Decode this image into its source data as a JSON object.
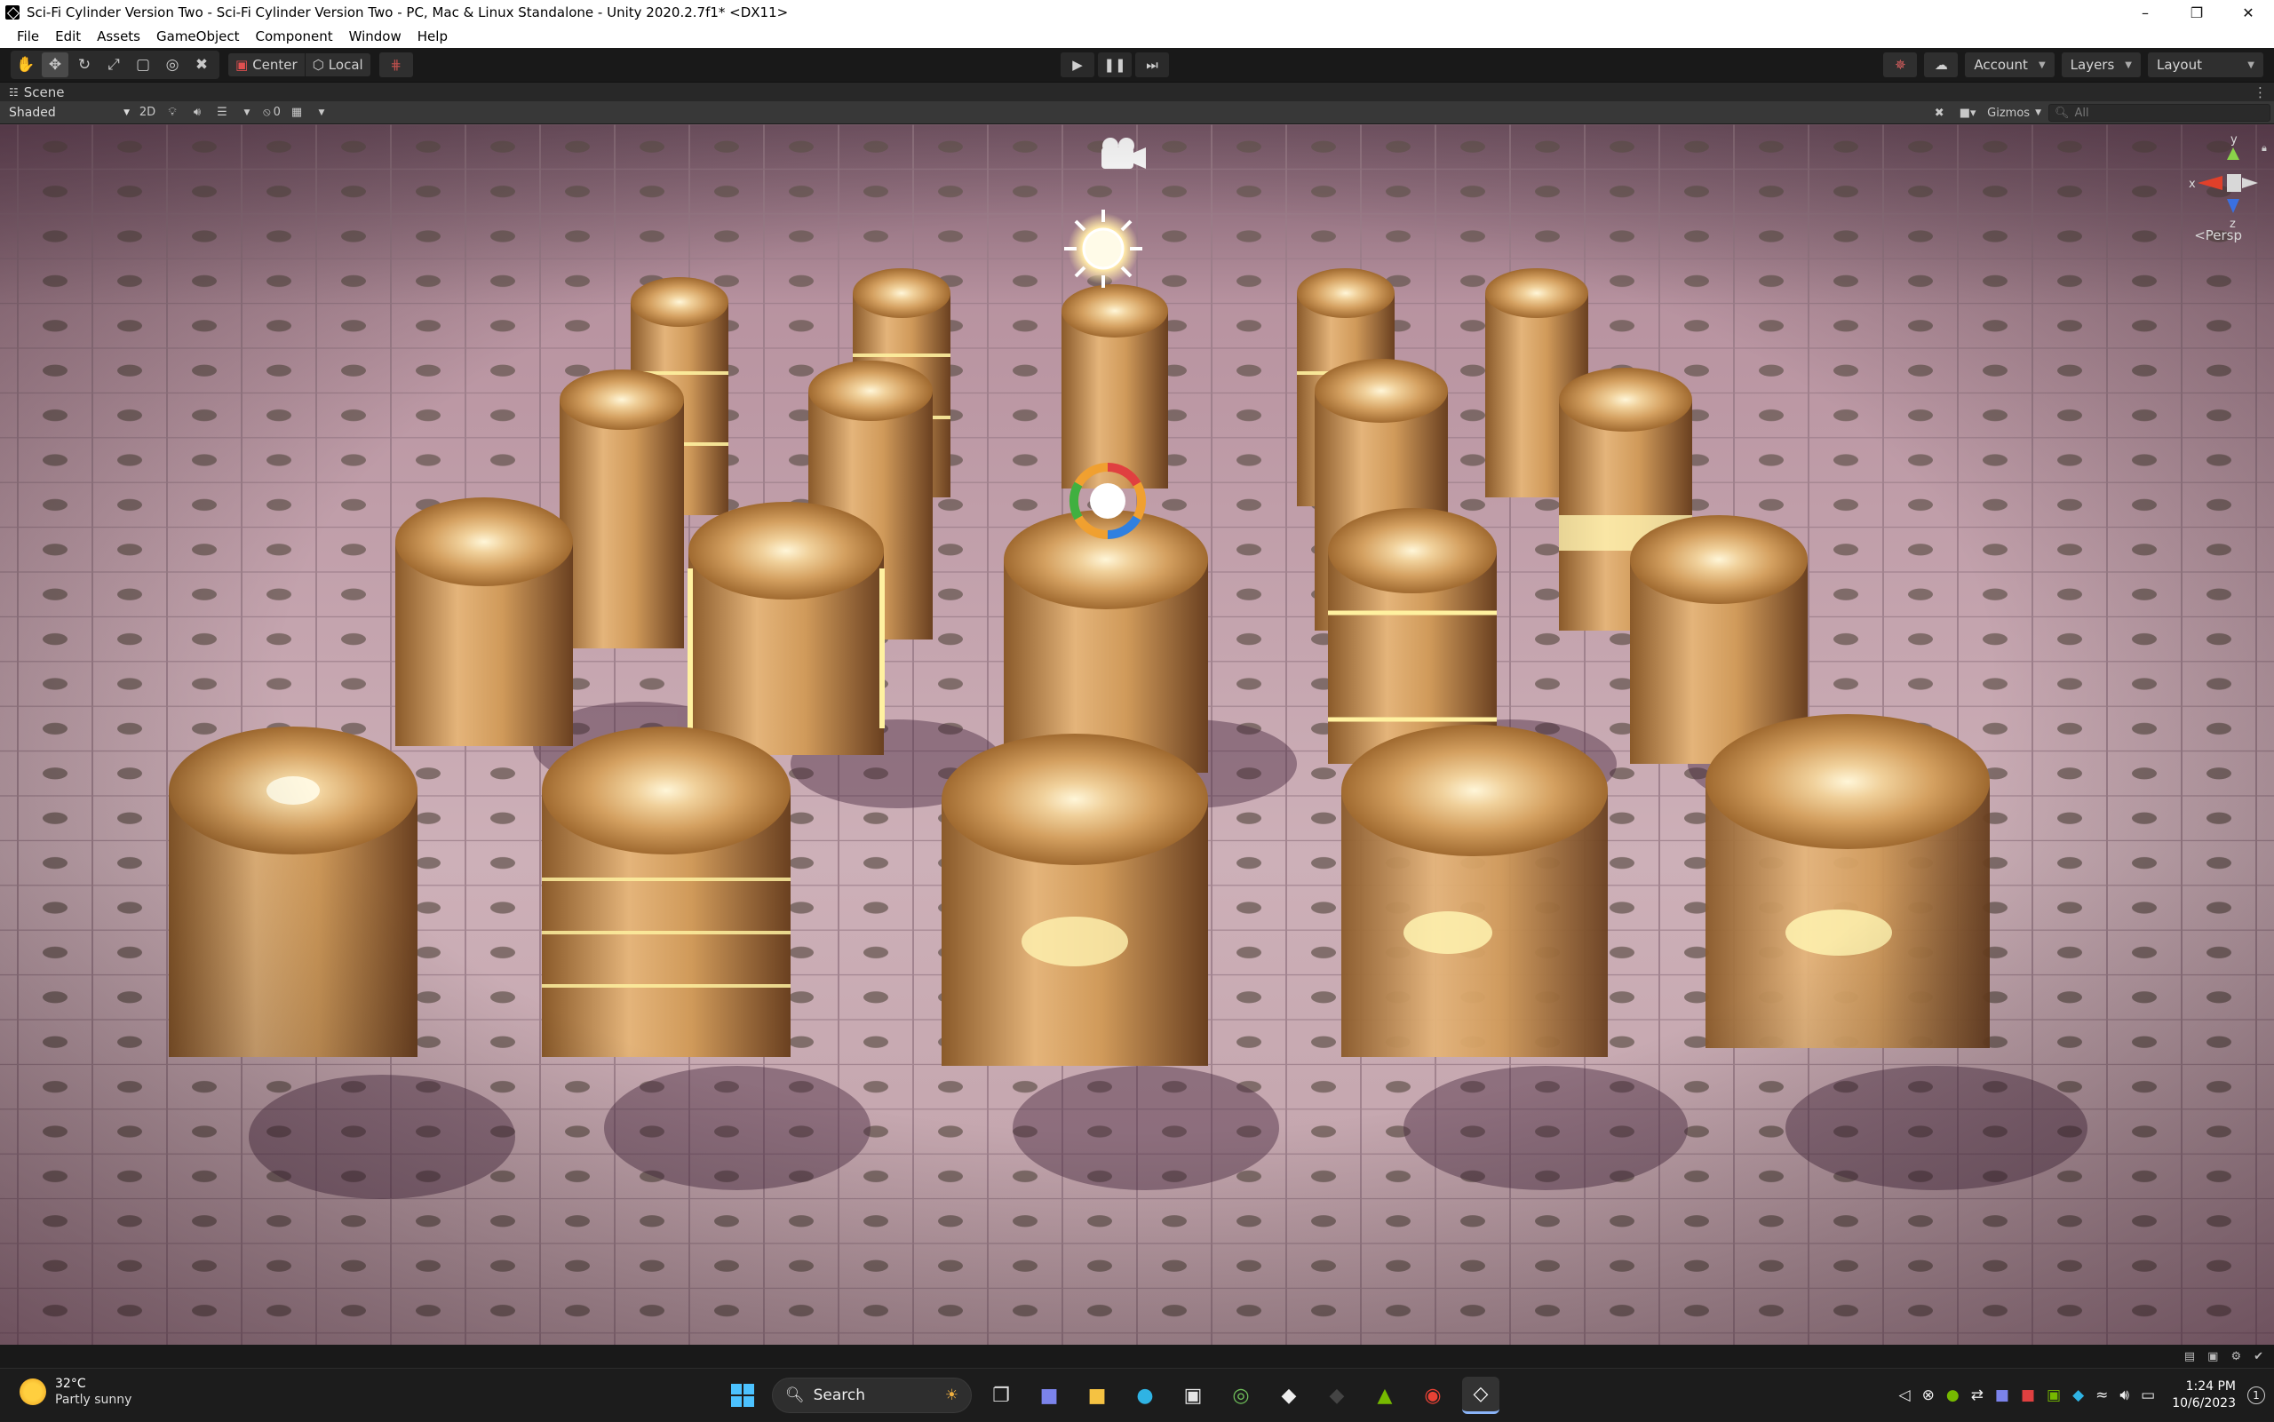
{
  "window": {
    "title": "Sci-Fi Cylinder Version Two - Sci-Fi Cylinder Version Two - PC, Mac & Linux Standalone - Unity 2020.2.7f1* <DX11>",
    "controls": [
      "minimize",
      "maximize",
      "close"
    ]
  },
  "menu": {
    "items": [
      "File",
      "Edit",
      "Assets",
      "GameObject",
      "Component",
      "Window",
      "Help"
    ]
  },
  "toolbar": {
    "tools": [
      "hand-tool",
      "move-tool",
      "rotate-tool",
      "scale-tool",
      "rect-tool",
      "transform-tool",
      "custom-tool"
    ],
    "active_tool": "move-tool",
    "pivot": "Center",
    "space": "Local",
    "account_label": "Account",
    "layers_label": "Layers",
    "layout_label": "Layout"
  },
  "scene_tab": {
    "label": "Scene"
  },
  "scene_toolbar": {
    "shading_mode": "Shaded",
    "mode_2d": "2D",
    "hidden_count": "0",
    "gizmos_label": "Gizmos",
    "search_placeholder": "All"
  },
  "viewport": {
    "projection": "<Persp",
    "axes": {
      "x": "x",
      "y": "y",
      "z": "z"
    },
    "colors": {
      "floor": "#c8a7b2",
      "tile_dot": "#6f6055",
      "cylinder": "#d8a868",
      "glow": "#fff3b0"
    }
  },
  "taskbar": {
    "weather_temp": "32°C",
    "weather_desc": "Partly sunny",
    "search_label": "Search",
    "time": "1:24 PM",
    "date": "10/6/2023"
  }
}
